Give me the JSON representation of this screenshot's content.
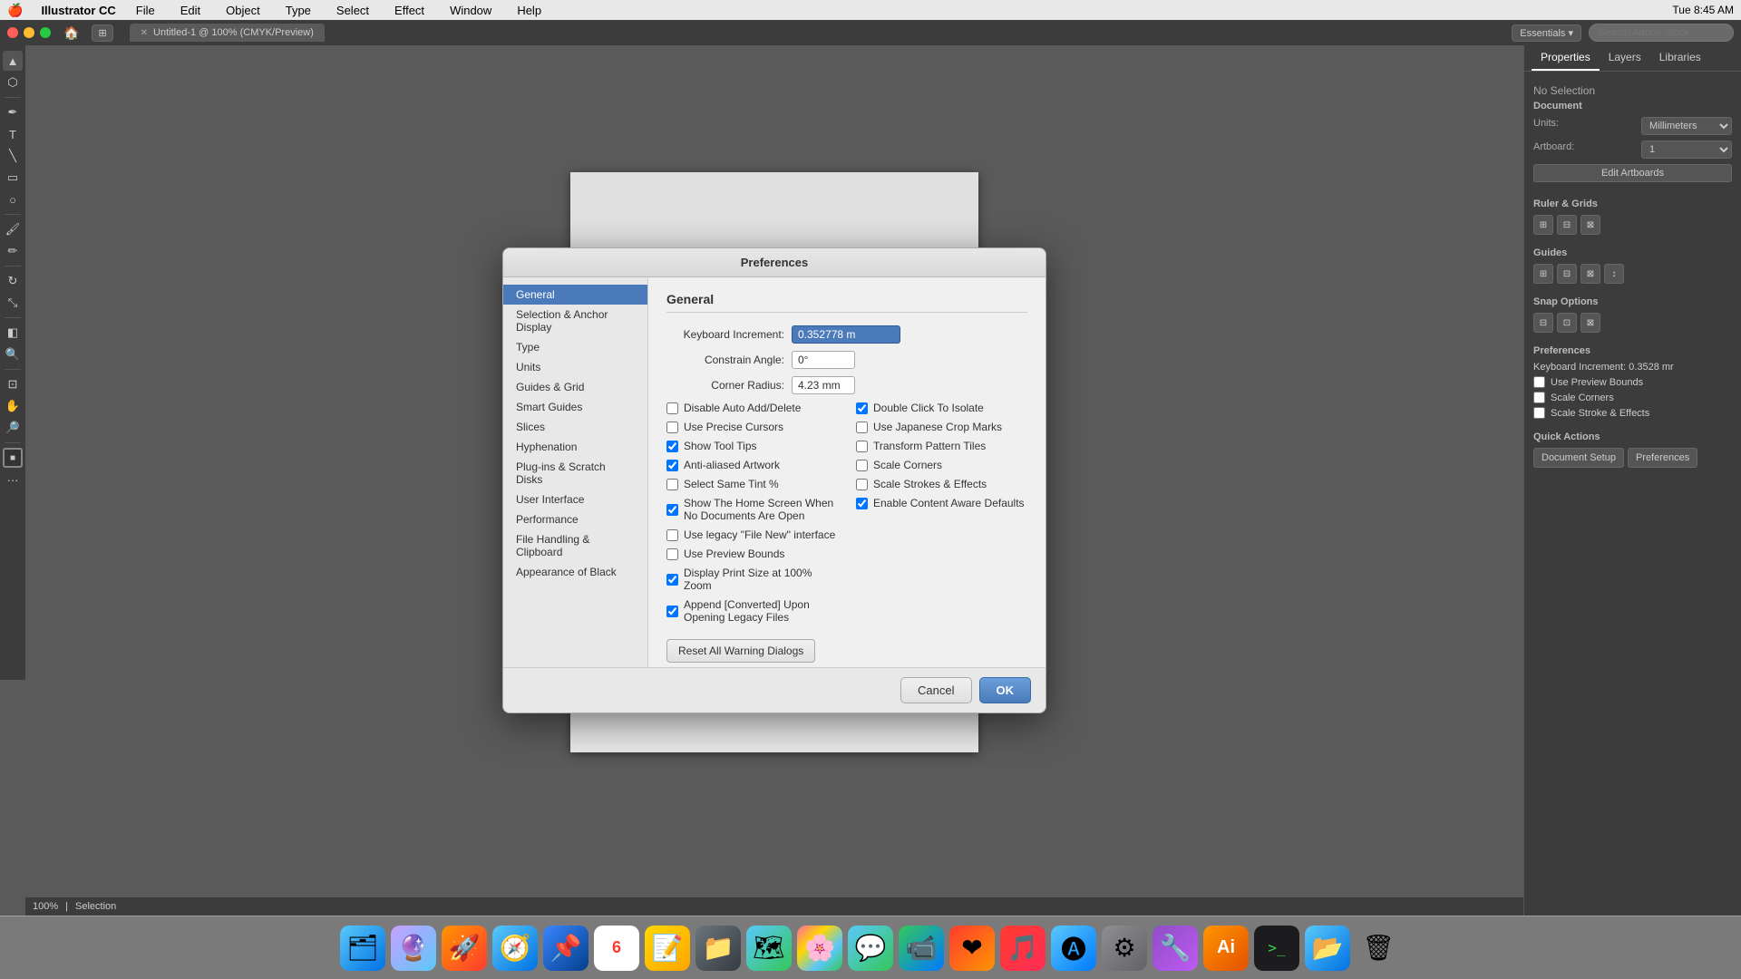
{
  "menubar": {
    "apple": "🍎",
    "appName": "Illustrator CC",
    "menus": [
      "File",
      "Edit",
      "Object",
      "Type",
      "Select",
      "Effect",
      "Window",
      "Help"
    ],
    "time": "Tue 8:45 AM",
    "essentials": "Essentials ▾",
    "searchStock": "Search Adobe Stock"
  },
  "toolbar": {
    "tabLabel": "Untitled-1 @ 100% (CMYK/Preview)"
  },
  "rightPanel": {
    "tabs": [
      "Properties",
      "Layers",
      "Libraries"
    ],
    "activeTab": "Properties",
    "noSelection": "No Selection",
    "documentLabel": "Document",
    "unitsLabel": "Units:",
    "unitsValue": "Millimeters",
    "artboardLabel": "Artboard:",
    "artboardValue": "1",
    "editArtboardsBtn": "Edit Artboards",
    "rulerGridsLabel": "Ruler & Grids",
    "guidesLabel": "Guides",
    "snapOptionsLabel": "Snap Options",
    "preferencesLabel": "Preferences",
    "prefKeyboard": "Keyboard Increment: 0.3528 mr",
    "prefPreviewBounds": "Use Preview Bounds",
    "prefScaleCorners": "Scale Corners",
    "prefScaleStroke": "Scale Stroke & Effects",
    "quickActionsLabel": "Quick Actions",
    "docSetupBtn": "Document Setup",
    "preferencesBtn": "Preferences"
  },
  "dialog": {
    "title": "Preferences",
    "sidebarItems": [
      "General",
      "Selection & Anchor Display",
      "Type",
      "Units",
      "Guides & Grid",
      "Smart Guides",
      "Slices",
      "Hyphenation",
      "Plug-ins & Scratch Disks",
      "User Interface",
      "Performance",
      "File Handling & Clipboard",
      "Appearance of Black"
    ],
    "activeItem": "General",
    "sectionTitle": "General",
    "keyboardIncrementLabel": "Keyboard Increment:",
    "keyboardIncrementValue": "0.352778 m",
    "constrainAngleLabel": "Constrain Angle:",
    "constrainAngleValue": "0°",
    "cornerRadiusLabel": "Corner Radius:",
    "cornerRadiusValue": "4.23 mm",
    "checkboxes": {
      "left": [
        {
          "id": "cb1",
          "label": "Disable Auto Add/Delete",
          "checked": false
        },
        {
          "id": "cb2",
          "label": "Use Precise Cursors",
          "checked": false
        },
        {
          "id": "cb3",
          "label": "Show Tool Tips",
          "checked": true
        },
        {
          "id": "cb4",
          "label": "Anti-aliased Artwork",
          "checked": true
        },
        {
          "id": "cb5",
          "label": "Select Same Tint %",
          "checked": false
        },
        {
          "id": "cb6",
          "label": "Show The Home Screen When No Documents Are Open",
          "checked": true
        },
        {
          "id": "cb7",
          "label": "Use legacy \"File New\" interface",
          "checked": false
        },
        {
          "id": "cb8",
          "label": "Use Preview Bounds",
          "checked": false
        },
        {
          "id": "cb9",
          "label": "Display Print Size at 100% Zoom",
          "checked": true
        },
        {
          "id": "cb10",
          "label": "Append [Converted] Upon Opening Legacy Files",
          "checked": true
        }
      ],
      "right": [
        {
          "id": "cbr1",
          "label": "Double Click To Isolate",
          "checked": true
        },
        {
          "id": "cbr2",
          "label": "Use Japanese Crop Marks",
          "checked": false
        },
        {
          "id": "cbr3",
          "label": "Transform Pattern Tiles",
          "checked": false
        },
        {
          "id": "cbr4",
          "label": "Scale Corners",
          "checked": false
        },
        {
          "id": "cbr5",
          "label": "Scale Strokes & Effects",
          "checked": false
        },
        {
          "id": "cbr6",
          "label": "Enable Content Aware Defaults",
          "checked": true
        }
      ]
    },
    "resetBtn": "Reset All Warning Dialogs",
    "cancelBtn": "Cancel",
    "okBtn": "OK"
  },
  "statusbar": {
    "zoom": "100%",
    "mode": "Selection"
  },
  "dock": {
    "items": [
      {
        "label": "Finder",
        "emoji": "🗂",
        "type": "finder"
      },
      {
        "label": "Siri",
        "emoji": "🔮",
        "type": "siri"
      },
      {
        "label": "Launchpad",
        "emoji": "🚀",
        "type": "launchpad"
      },
      {
        "label": "Safari",
        "emoji": "🧭",
        "type": "safari"
      },
      {
        "label": "App4",
        "emoji": "📌",
        "type": "app4"
      },
      {
        "label": "Calendar",
        "emoji": "6",
        "type": "cal"
      },
      {
        "label": "Notes",
        "emoji": "📝",
        "type": "notes"
      },
      {
        "label": "Files",
        "emoji": "📁",
        "type": "files"
      },
      {
        "label": "Maps",
        "emoji": "🗺",
        "type": "maps"
      },
      {
        "label": "Photos",
        "emoji": "🌸",
        "type": "photos"
      },
      {
        "label": "Messages",
        "emoji": "💬",
        "type": "msg"
      },
      {
        "label": "FaceTime",
        "emoji": "📹",
        "type": "facetime"
      },
      {
        "label": "Fantastical",
        "emoji": "❤",
        "type": "fantastical"
      },
      {
        "label": "Music",
        "emoji": "🎵",
        "type": "music"
      },
      {
        "label": "App Store",
        "emoji": "🅐",
        "type": "appstore"
      },
      {
        "label": "System Pref.",
        "emoji": "⚙",
        "type": "sys"
      },
      {
        "label": "Misc",
        "emoji": "🔧",
        "type": "misc"
      },
      {
        "label": "Illustrator CC",
        "text": "Ai",
        "type": "ai"
      },
      {
        "label": "Terminal",
        "text": ">_",
        "type": "terminal"
      },
      {
        "label": "Folder",
        "emoji": "📂",
        "type": "folder"
      },
      {
        "label": "Trash",
        "emoji": "🗑",
        "type": "trash"
      }
    ]
  }
}
